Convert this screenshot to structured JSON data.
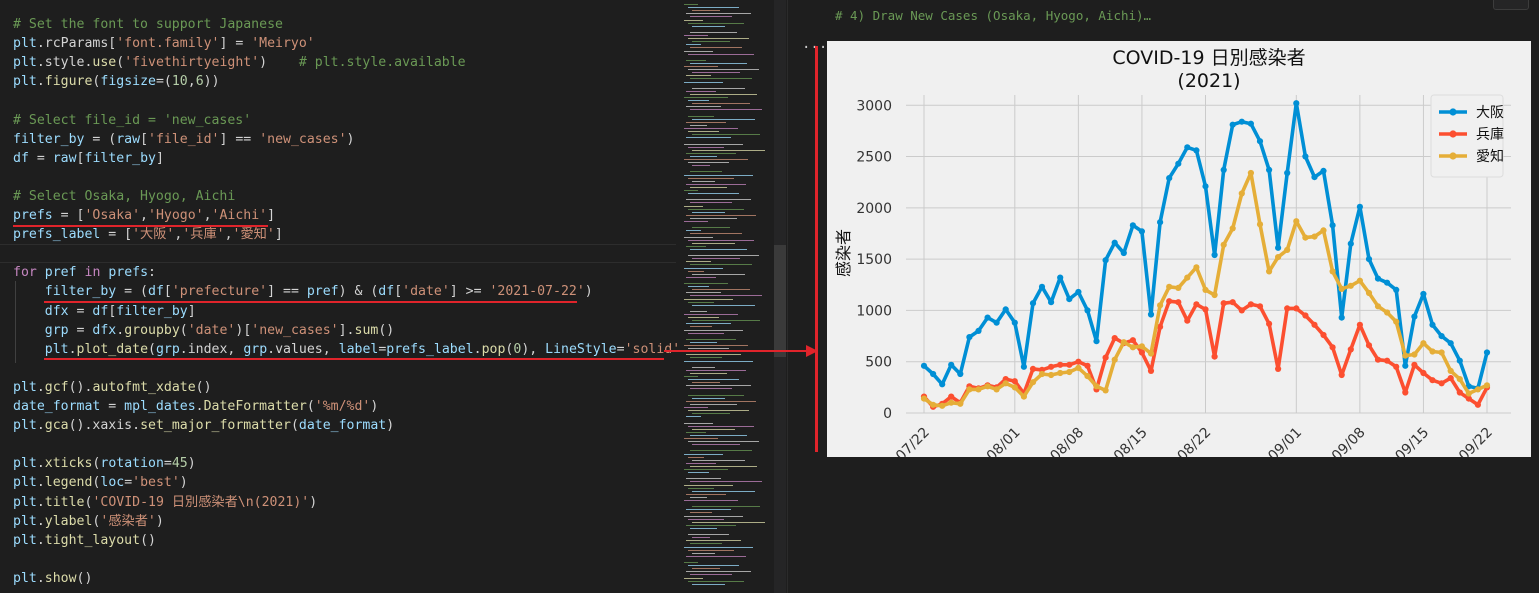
{
  "editor": {
    "lines": [
      [
        {
          "t": "# Set the font to support Japanese",
          "c": "comment"
        }
      ],
      [
        {
          "t": "plt",
          "c": "var"
        },
        {
          "t": ".rcParams[",
          "c": "plain"
        },
        {
          "t": "'font.family'",
          "c": "string"
        },
        {
          "t": "] = ",
          "c": "plain"
        },
        {
          "t": "'Meiryo'",
          "c": "string"
        }
      ],
      [
        {
          "t": "plt",
          "c": "var"
        },
        {
          "t": ".style.",
          "c": "plain"
        },
        {
          "t": "use",
          "c": "func"
        },
        {
          "t": "(",
          "c": "plain"
        },
        {
          "t": "'fivethirtyeight'",
          "c": "string"
        },
        {
          "t": ")    ",
          "c": "plain"
        },
        {
          "t": "# plt.style.available",
          "c": "comment"
        }
      ],
      [
        {
          "t": "plt",
          "c": "var"
        },
        {
          "t": ".",
          "c": "plain"
        },
        {
          "t": "figure",
          "c": "func"
        },
        {
          "t": "(",
          "c": "plain"
        },
        {
          "t": "figsize",
          "c": "var"
        },
        {
          "t": "=(",
          "c": "plain"
        },
        {
          "t": "10",
          "c": "num"
        },
        {
          "t": ",",
          "c": "plain"
        },
        {
          "t": "6",
          "c": "num"
        },
        {
          "t": "))",
          "c": "plain"
        }
      ],
      [],
      [
        {
          "t": "# Select file_id = 'new_cases'",
          "c": "comment"
        }
      ],
      [
        {
          "t": "filter_by",
          "c": "var"
        },
        {
          "t": " = (",
          "c": "plain"
        },
        {
          "t": "raw",
          "c": "var"
        },
        {
          "t": "[",
          "c": "plain"
        },
        {
          "t": "'file_id'",
          "c": "string"
        },
        {
          "t": "] == ",
          "c": "plain"
        },
        {
          "t": "'new_cases'",
          "c": "string"
        },
        {
          "t": ")",
          "c": "plain"
        }
      ],
      [
        {
          "t": "df",
          "c": "var"
        },
        {
          "t": " = ",
          "c": "plain"
        },
        {
          "t": "raw",
          "c": "var"
        },
        {
          "t": "[",
          "c": "plain"
        },
        {
          "t": "filter_by",
          "c": "var"
        },
        {
          "t": "]",
          "c": "plain"
        }
      ],
      [],
      [
        {
          "t": "# Select Osaka, Hyogo, Aichi",
          "c": "comment"
        }
      ],
      [
        {
          "t": "prefs",
          "c": "var"
        },
        {
          "t": " = [",
          "c": "plain"
        },
        {
          "t": "'Osaka'",
          "c": "string"
        },
        {
          "t": ",",
          "c": "plain"
        },
        {
          "t": "'Hyogo'",
          "c": "string"
        },
        {
          "t": ",",
          "c": "plain"
        },
        {
          "t": "'Aichi'",
          "c": "string"
        },
        {
          "t": "]",
          "c": "plain"
        }
      ],
      [
        {
          "t": "prefs_label",
          "c": "var"
        },
        {
          "t": " = [",
          "c": "plain"
        },
        {
          "t": "'大阪'",
          "c": "string"
        },
        {
          "t": ",",
          "c": "plain"
        },
        {
          "t": "'兵庫'",
          "c": "string"
        },
        {
          "t": ",",
          "c": "plain"
        },
        {
          "t": "'愛知'",
          "c": "string"
        },
        {
          "t": "]",
          "c": "plain"
        }
      ],
      [],
      [
        {
          "t": "for",
          "c": "keyword"
        },
        {
          "t": " ",
          "c": "plain"
        },
        {
          "t": "pref",
          "c": "var"
        },
        {
          "t": " ",
          "c": "plain"
        },
        {
          "t": "in",
          "c": "keyword"
        },
        {
          "t": " ",
          "c": "plain"
        },
        {
          "t": "prefs",
          "c": "var"
        },
        {
          "t": ":",
          "c": "plain"
        }
      ],
      [
        {
          "t": "    ",
          "c": "plain"
        },
        {
          "t": "filter_by",
          "c": "var"
        },
        {
          "t": " = (",
          "c": "plain"
        },
        {
          "t": "df",
          "c": "var"
        },
        {
          "t": "[",
          "c": "plain"
        },
        {
          "t": "'prefecture'",
          "c": "string"
        },
        {
          "t": "] == ",
          "c": "plain"
        },
        {
          "t": "pref",
          "c": "var"
        },
        {
          "t": ") & (",
          "c": "plain"
        },
        {
          "t": "df",
          "c": "var"
        },
        {
          "t": "[",
          "c": "plain"
        },
        {
          "t": "'date'",
          "c": "string"
        },
        {
          "t": "] >= ",
          "c": "plain"
        },
        {
          "t": "'2021-07-22'",
          "c": "string"
        },
        {
          "t": ")",
          "c": "plain"
        }
      ],
      [
        {
          "t": "    ",
          "c": "plain"
        },
        {
          "t": "dfx",
          "c": "var"
        },
        {
          "t": " = ",
          "c": "plain"
        },
        {
          "t": "df",
          "c": "var"
        },
        {
          "t": "[",
          "c": "plain"
        },
        {
          "t": "filter_by",
          "c": "var"
        },
        {
          "t": "]",
          "c": "plain"
        }
      ],
      [
        {
          "t": "    ",
          "c": "plain"
        },
        {
          "t": "grp",
          "c": "var"
        },
        {
          "t": " = ",
          "c": "plain"
        },
        {
          "t": "dfx",
          "c": "var"
        },
        {
          "t": ".",
          "c": "plain"
        },
        {
          "t": "groupby",
          "c": "func"
        },
        {
          "t": "(",
          "c": "plain"
        },
        {
          "t": "'date'",
          "c": "string"
        },
        {
          "t": ")[",
          "c": "plain"
        },
        {
          "t": "'new_cases'",
          "c": "string"
        },
        {
          "t": "].",
          "c": "plain"
        },
        {
          "t": "sum",
          "c": "func"
        },
        {
          "t": "()",
          "c": "plain"
        }
      ],
      [
        {
          "t": "    ",
          "c": "plain"
        },
        {
          "t": "plt",
          "c": "var"
        },
        {
          "t": ".",
          "c": "plain"
        },
        {
          "t": "plot_date",
          "c": "func"
        },
        {
          "t": "(",
          "c": "plain"
        },
        {
          "t": "grp",
          "c": "var"
        },
        {
          "t": ".index, ",
          "c": "plain"
        },
        {
          "t": "grp",
          "c": "var"
        },
        {
          "t": ".values, ",
          "c": "plain"
        },
        {
          "t": "label",
          "c": "var"
        },
        {
          "t": "=",
          "c": "plain"
        },
        {
          "t": "prefs_label",
          "c": "var"
        },
        {
          "t": ".",
          "c": "plain"
        },
        {
          "t": "pop",
          "c": "func"
        },
        {
          "t": "(",
          "c": "plain"
        },
        {
          "t": "0",
          "c": "num"
        },
        {
          "t": "), ",
          "c": "plain"
        },
        {
          "t": "LineStyle",
          "c": "var"
        },
        {
          "t": "=",
          "c": "plain"
        },
        {
          "t": "'solid'",
          "c": "string"
        },
        {
          "t": ")",
          "c": "plain"
        }
      ],
      [],
      [
        {
          "t": "plt",
          "c": "var"
        },
        {
          "t": ".",
          "c": "plain"
        },
        {
          "t": "gcf",
          "c": "func"
        },
        {
          "t": "().",
          "c": "plain"
        },
        {
          "t": "autofmt_xdate",
          "c": "func"
        },
        {
          "t": "()",
          "c": "plain"
        }
      ],
      [
        {
          "t": "date_format",
          "c": "var"
        },
        {
          "t": " = ",
          "c": "plain"
        },
        {
          "t": "mpl_dates",
          "c": "var"
        },
        {
          "t": ".",
          "c": "plain"
        },
        {
          "t": "DateFormatter",
          "c": "func"
        },
        {
          "t": "(",
          "c": "plain"
        },
        {
          "t": "'%m/%d'",
          "c": "string"
        },
        {
          "t": ")",
          "c": "plain"
        }
      ],
      [
        {
          "t": "plt",
          "c": "var"
        },
        {
          "t": ".",
          "c": "plain"
        },
        {
          "t": "gca",
          "c": "func"
        },
        {
          "t": "().xaxis.",
          "c": "plain"
        },
        {
          "t": "set_major_formatter",
          "c": "func"
        },
        {
          "t": "(",
          "c": "plain"
        },
        {
          "t": "date_format",
          "c": "var"
        },
        {
          "t": ")",
          "c": "plain"
        }
      ],
      [],
      [
        {
          "t": "plt",
          "c": "var"
        },
        {
          "t": ".",
          "c": "plain"
        },
        {
          "t": "xticks",
          "c": "func"
        },
        {
          "t": "(",
          "c": "plain"
        },
        {
          "t": "rotation",
          "c": "var"
        },
        {
          "t": "=",
          "c": "plain"
        },
        {
          "t": "45",
          "c": "num"
        },
        {
          "t": ")",
          "c": "plain"
        }
      ],
      [
        {
          "t": "plt",
          "c": "var"
        },
        {
          "t": ".",
          "c": "plain"
        },
        {
          "t": "legend",
          "c": "func"
        },
        {
          "t": "(",
          "c": "plain"
        },
        {
          "t": "loc",
          "c": "var"
        },
        {
          "t": "=",
          "c": "plain"
        },
        {
          "t": "'best'",
          "c": "string"
        },
        {
          "t": ")",
          "c": "plain"
        }
      ],
      [
        {
          "t": "plt",
          "c": "var"
        },
        {
          "t": ".",
          "c": "plain"
        },
        {
          "t": "title",
          "c": "func"
        },
        {
          "t": "(",
          "c": "plain"
        },
        {
          "t": "'COVID-19 日別感染者\\n(2021)'",
          "c": "string"
        },
        {
          "t": ")",
          "c": "plain"
        }
      ],
      [
        {
          "t": "plt",
          "c": "var"
        },
        {
          "t": ".",
          "c": "plain"
        },
        {
          "t": "ylabel",
          "c": "func"
        },
        {
          "t": "(",
          "c": "plain"
        },
        {
          "t": "'感染者'",
          "c": "string"
        },
        {
          "t": ")",
          "c": "plain"
        }
      ],
      [
        {
          "t": "plt",
          "c": "var"
        },
        {
          "t": ".",
          "c": "plain"
        },
        {
          "t": "tight_layout",
          "c": "func"
        },
        {
          "t": "()",
          "c": "plain"
        }
      ],
      [],
      [
        {
          "t": "plt",
          "c": "var"
        },
        {
          "t": ".",
          "c": "plain"
        },
        {
          "t": "show",
          "c": "func"
        },
        {
          "t": "()",
          "c": "plain"
        }
      ]
    ]
  },
  "output": {
    "cell_comment": "# 4) Draw New Cases (Osaka, Hyogo, Aichi)…",
    "more_dots": "..."
  },
  "colors": {
    "accent_red": "#e0242b",
    "osaka": "#008fd5",
    "hyogo": "#fc4f30",
    "aichi": "#e5ae38"
  },
  "chart_data": {
    "type": "line",
    "title": "COVID-19 日別感染者",
    "subtitle": "(2021)",
    "xlabel": "",
    "ylabel": "感染者",
    "x_start": "2021-07-22",
    "x_tick_labels": [
      "07/22",
      "08/01",
      "08/08",
      "08/15",
      "08/22",
      "09/01",
      "09/08",
      "09/15",
      "09/22"
    ],
    "x_tick_dates": [
      "2021-07-22",
      "2021-08-01",
      "2021-08-08",
      "2021-08-15",
      "2021-08-22",
      "2021-09-01",
      "2021-09-08",
      "2021-09-15",
      "2021-09-22"
    ],
    "ylim": [
      0,
      3100
    ],
    "y_ticks": [
      0,
      500,
      1000,
      1500,
      2000,
      2500,
      3000
    ],
    "grid": true,
    "legend_position": "top-right",
    "series": [
      {
        "name": "大阪",
        "color": "#008fd5",
        "values": [
          460,
          380,
          280,
          470,
          380,
          740,
          800,
          930,
          880,
          1010,
          880,
          450,
          1070,
          1230,
          1080,
          1320,
          1110,
          1180,
          1000,
          700,
          1490,
          1660,
          1560,
          1830,
          1770,
          960,
          1860,
          2290,
          2430,
          2590,
          2560,
          2210,
          1540,
          2370,
          2810,
          2840,
          2820,
          2650,
          2370,
          1610,
          2340,
          3020,
          2500,
          2300,
          2360,
          1830,
          930,
          1650,
          2010,
          1500,
          1310,
          1270,
          1200,
          460,
          940,
          1160,
          860,
          750,
          680,
          510,
          260,
          240,
          590
        ]
      },
      {
        "name": "兵庫",
        "color": "#fc4f30",
        "values": [
          160,
          60,
          90,
          160,
          100,
          260,
          240,
          270,
          250,
          330,
          310,
          190,
          430,
          420,
          450,
          470,
          470,
          500,
          460,
          230,
          540,
          730,
          680,
          710,
          590,
          410,
          840,
          1090,
          1080,
          900,
          1060,
          1010,
          550,
          1070,
          1080,
          1000,
          1060,
          1040,
          870,
          430,
          1020,
          1020,
          950,
          860,
          760,
          640,
          370,
          620,
          860,
          660,
          520,
          510,
          450,
          200,
          470,
          390,
          320,
          290,
          340,
          200,
          140,
          80,
          250
        ]
      },
      {
        "name": "愛知",
        "color": "#e5ae38",
        "values": [
          140,
          80,
          70,
          100,
          90,
          230,
          230,
          260,
          230,
          290,
          250,
          160,
          300,
          380,
          370,
          390,
          400,
          440,
          360,
          260,
          220,
          520,
          690,
          640,
          650,
          580,
          1050,
          1230,
          1220,
          1320,
          1420,
          1200,
          1150,
          1640,
          1800,
          2140,
          2340,
          1840,
          1380,
          1520,
          1590,
          1870,
          1710,
          1720,
          1780,
          1380,
          1210,
          1240,
          1290,
          1170,
          1040,
          980,
          890,
          560,
          570,
          680,
          600,
          590,
          410,
          330,
          190,
          230,
          270
        ]
      }
    ]
  }
}
